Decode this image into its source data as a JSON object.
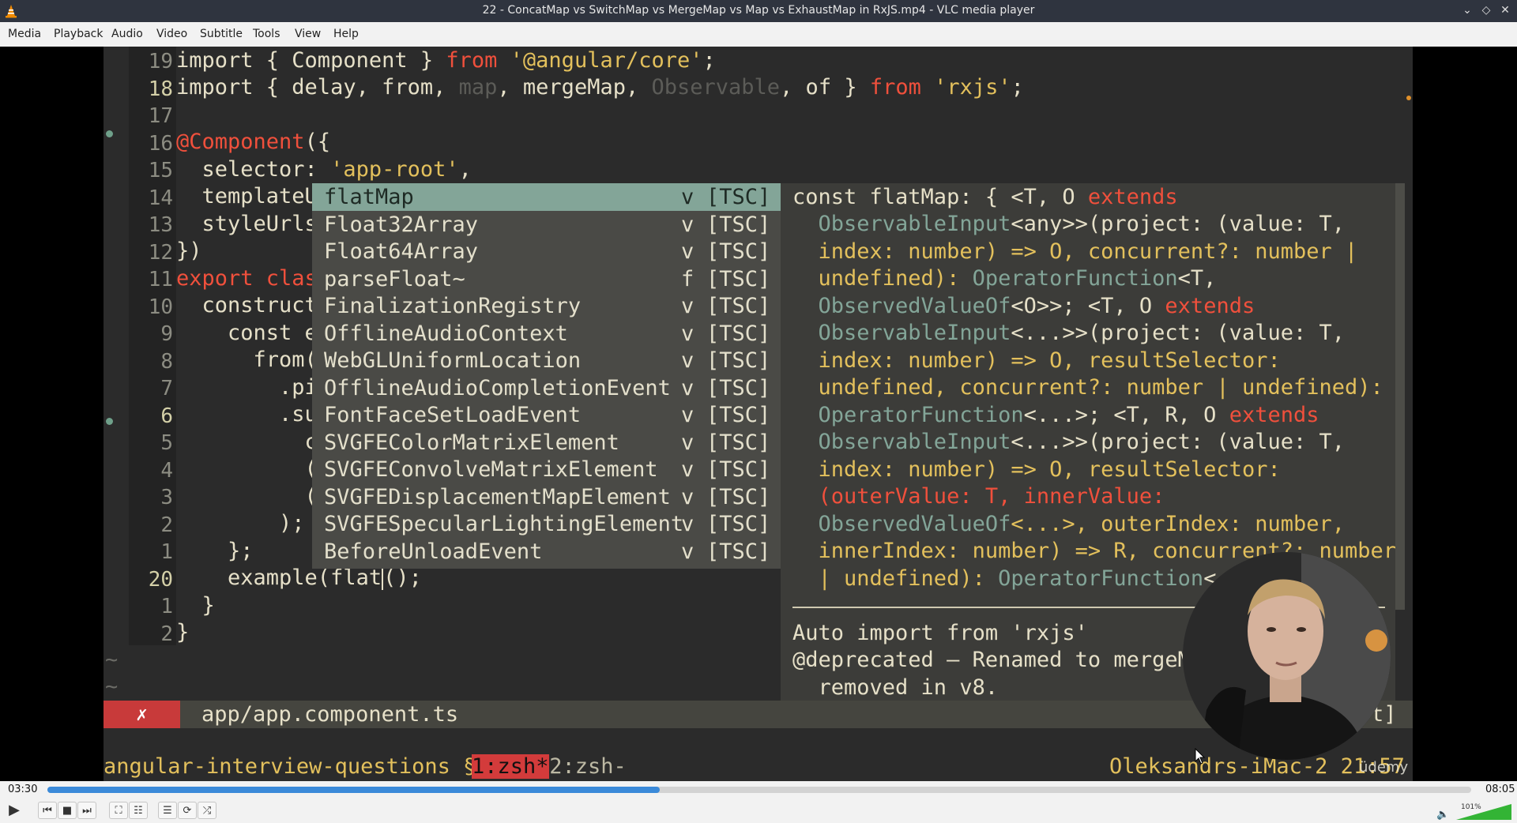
{
  "window": {
    "title": "22 - ConcatMap vs SwitchMap vs MergeMap vs Map vs ExhaustMap in RxJS.mp4 - VLC media player"
  },
  "menu": [
    "Media",
    "Playback",
    "Audio",
    "Video",
    "Subtitle",
    "Tools",
    "View",
    "Help"
  ],
  "editor": {
    "lines": [
      {
        "num": "19",
        "cur": false
      },
      {
        "num": "18",
        "cur": true
      },
      {
        "num": "17",
        "cur": false
      },
      {
        "num": "16",
        "cur": false
      },
      {
        "num": "15",
        "cur": false
      },
      {
        "num": "14",
        "cur": false
      },
      {
        "num": "13",
        "cur": false
      },
      {
        "num": "12",
        "cur": false
      },
      {
        "num": "11",
        "cur": false
      },
      {
        "num": "10",
        "cur": false
      },
      {
        "num": "9",
        "cur": false
      },
      {
        "num": "8",
        "cur": false
      },
      {
        "num": "7",
        "cur": false
      },
      {
        "num": "6",
        "cur": true
      },
      {
        "num": "5",
        "cur": false
      },
      {
        "num": "4",
        "cur": false
      },
      {
        "num": "3",
        "cur": false
      },
      {
        "num": "2",
        "cur": false
      },
      {
        "num": "1",
        "cur": false
      },
      {
        "num": "20",
        "cur": true
      },
      {
        "num": "1",
        "cur": false
      },
      {
        "num": "2",
        "cur": false
      }
    ],
    "code": {
      "l19_a": "import { Component } ",
      "l19_b": "from",
      "l19_c": " '@angular/core'",
      "l19_d": ";",
      "l18_a": "import { delay, from, ",
      "l18_b": "map",
      "l18_c": ", mergeMap, ",
      "l18_d": "Observable",
      "l18_e": ", of } ",
      "l18_f": "from",
      "l18_g": " 'rxjs'",
      "l18_h": ";",
      "l16_a": "@Component",
      "l16_b": "({",
      "l15_a": "  selector: ",
      "l15_b": "'app-root'",
      "l15_c": ",",
      "l14": "  templateU",
      "l13": "  styleUrls",
      "l12": "})",
      "l11_a": "export clas",
      "l10": "  construct",
      "l9": "    const e",
      "l8": "      from(",
      "l7": "        .pi",
      "l6": "        .su",
      "l5": "          c",
      "l4": "          (",
      "l3": "          (",
      "l2": "        );",
      "l1": "    };",
      "l20_a": "    example(flat",
      "l20_b": "();",
      "l1b": "  }",
      "l2b": "}",
      "tilde": "~"
    }
  },
  "completion": [
    {
      "name": "flatMap",
      "kind": "v",
      "source": "[TSC]",
      "selected": true
    },
    {
      "name": "Float32Array",
      "kind": "v",
      "source": "[TSC]",
      "selected": false
    },
    {
      "name": "Float64Array",
      "kind": "v",
      "source": "[TSC]",
      "selected": false
    },
    {
      "name": "parseFloat~",
      "kind": "f",
      "source": "[TSC]",
      "selected": false
    },
    {
      "name": "FinalizationRegistry",
      "kind": "v",
      "source": "[TSC]",
      "selected": false
    },
    {
      "name": "OfflineAudioContext",
      "kind": "v",
      "source": "[TSC]",
      "selected": false
    },
    {
      "name": "WebGLUniformLocation",
      "kind": "v",
      "source": "[TSC]",
      "selected": false
    },
    {
      "name": "OfflineAudioCompletionEvent",
      "kind": "v",
      "source": "[TSC]",
      "selected": false
    },
    {
      "name": "FontFaceSetLoadEvent",
      "kind": "v",
      "source": "[TSC]",
      "selected": false
    },
    {
      "name": "SVGFEColorMatrixElement",
      "kind": "v",
      "source": "[TSC]",
      "selected": false
    },
    {
      "name": "SVGFEConvolveMatrixElement",
      "kind": "v",
      "source": "[TSC]",
      "selected": false
    },
    {
      "name": "SVGFEDisplacementMapElement",
      "kind": "v",
      "source": "[TSC]",
      "selected": false
    },
    {
      "name": "SVGFESpecularLightingElement",
      "kind": "v",
      "source": "[TSC]",
      "selected": false
    },
    {
      "name": "BeforeUnloadEvent",
      "kind": "v",
      "source": "[TSC]",
      "selected": false
    }
  ],
  "doc": {
    "d1a": "const flatMap: { <T, O ",
    "d1b": "extends",
    "d2a": "  ObservableInput",
    "d2b": "<any>>(project: (value: T,",
    "d3a": "  index: number) => O, concurrent?: number |",
    "d4a": "  undefined): ",
    "d4b": "OperatorFunction",
    "d4c": "<T,",
    "d5a": "  ObservedValueOf",
    "d5b": "<O>>; <T, O ",
    "d5c": "extends",
    "d6a": "  ObservableInput",
    "d6b": "<...>>(project: (value: T,",
    "d7a": "  index: number) => O, resultSelector:",
    "d8a": "  undefined, concurrent?: number | undefined):",
    "d9a": "  OperatorFunction",
    "d9b": "<...>; <T, R, O ",
    "d9c": "extends",
    "d10a": "  ObservableInput",
    "d10b": "<...>>(project: (value: T,",
    "d11a": "  index: number) => O, resultSelector:",
    "d12a": "  (outerValue: T, innerValue:",
    "d13a": "  ObservedValueOf",
    "d13b": "<...>, outerIndex: number,",
    "d14a": "  innerIndex: number) => R, concurrent?: number",
    "d15a": "  | undefined): ",
    "d15b": "OperatorFunction",
    "d15c": "<...",
    "d16": "Auto import from 'rxjs'",
    "d17": "@deprecated — Renamed to mergeMa",
    "d18": "  removed in v8.",
    "d_tail": "t]"
  },
  "statusline": {
    "error_mark": "✗",
    "file": "app/app.component.ts"
  },
  "tmux": {
    "session": "angular-interview-questions § ",
    "win1": "1:zsh*",
    "win2": " 2:zsh-",
    "host": "Oleksandrs-iMac-2 21:57"
  },
  "watermark": "üdemy",
  "player": {
    "elapsed": "03:30",
    "total": "08:05",
    "progress": 0.4299,
    "volume": "101%"
  }
}
